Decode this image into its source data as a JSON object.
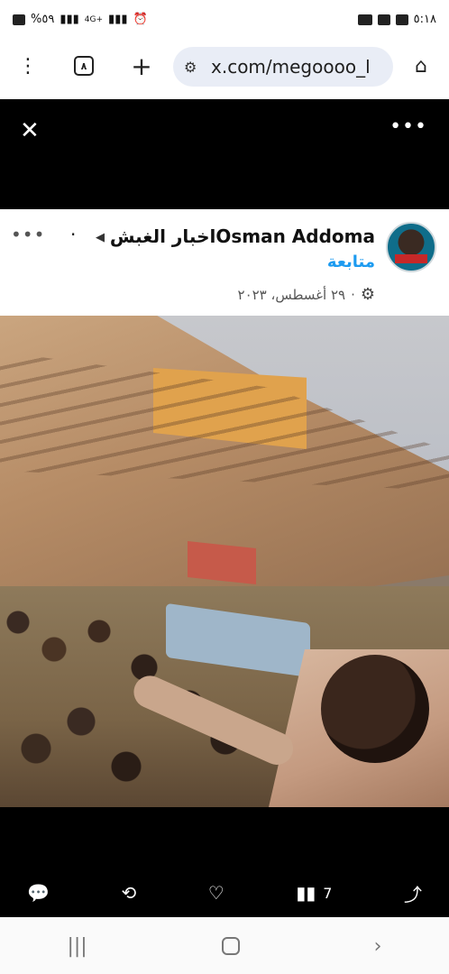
{
  "status_bar": {
    "left": "%٥٩",
    "network": "4G+",
    "time": "٥:١٨"
  },
  "browser": {
    "url": "x.com/megoooo_ا",
    "tabs_count": "٨",
    "menu_icon": "three-dots-vertical-icon",
    "new_tab_icon": "plus-icon",
    "home_icon": "home-icon"
  },
  "media_viewer": {
    "close_icon": "close-icon",
    "more_icon": "more-horizontal-icon"
  },
  "post": {
    "author_name": "اخبار الغبشOsman Addoma",
    "follow_label": "متابعة",
    "date": "٢٩ أغسطس، ٢٠٢٣",
    "date_separator": "·",
    "gear_icon": "gear-icon",
    "more_icon": "more-horizontal-icon"
  },
  "actions": {
    "reply_icon": "reply-icon",
    "repost_icon": "repost-icon",
    "like_icon": "heart-icon",
    "views_icon": "bar-chart-icon",
    "views_count": "7",
    "share_icon": "share-icon"
  },
  "system_nav": {
    "recents_icon": "recent-apps-icon",
    "home_icon": "home-circle-icon",
    "back_icon": "back-icon"
  }
}
